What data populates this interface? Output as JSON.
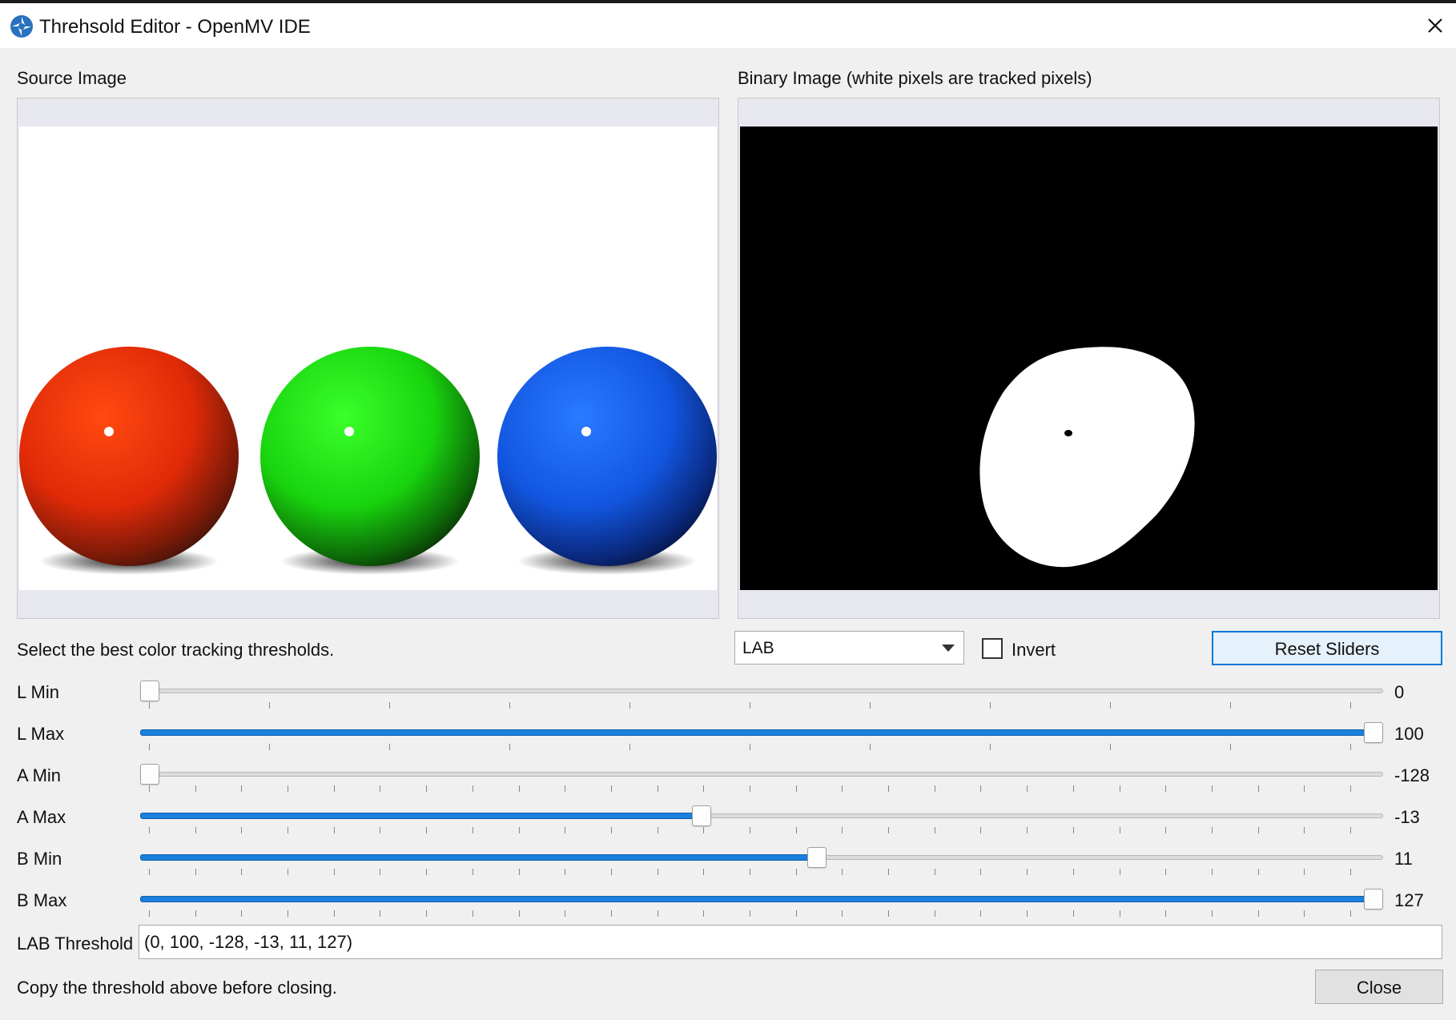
{
  "window": {
    "title": "Threhsold Editor - OpenMV IDE"
  },
  "source_label": "Source Image",
  "binary_label": "Binary Image (white pixels are tracked pixels)",
  "instructions": "Select the best color tracking thresholds.",
  "color_space": {
    "selected": "LAB"
  },
  "invert": {
    "label": "Invert",
    "checked": false
  },
  "reset_button": "Reset Sliders",
  "sliders": [
    {
      "name": "L Min",
      "value": "0",
      "fraction": 0.0,
      "filled": false
    },
    {
      "name": "L Max",
      "value": "100",
      "fraction": 1.0,
      "filled": true
    },
    {
      "name": "A Min",
      "value": "-128",
      "fraction": 0.0,
      "filled": false
    },
    {
      "name": "A Max",
      "value": "-13",
      "fraction": 0.451,
      "filled": true
    },
    {
      "name": "B Min",
      "value": "11",
      "fraction": 0.545,
      "filled": true
    },
    {
      "name": "B Max",
      "value": "127",
      "fraction": 1.0,
      "filled": true
    }
  ],
  "threshold": {
    "label": "LAB Threshold",
    "value": "(0, 100, -128, -13, 11, 127)"
  },
  "footer_note": "Copy the threshold above before closing.",
  "close_button": "Close",
  "colors": {
    "accent": "#0078d7",
    "slider_fill": "#1a7fdd"
  }
}
